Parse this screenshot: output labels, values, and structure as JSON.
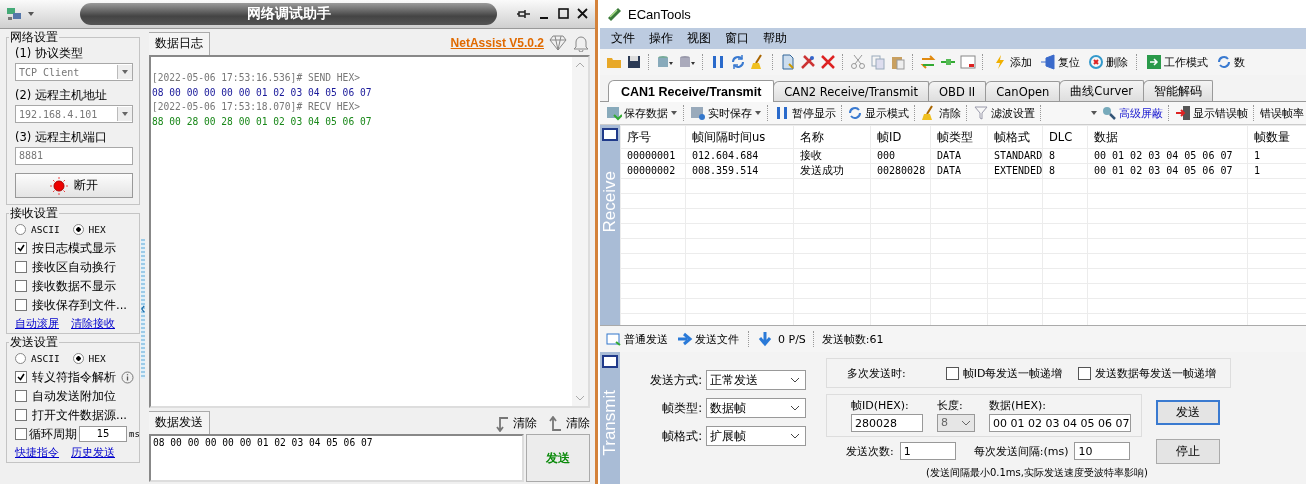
{
  "net_assist": {
    "window": {
      "title": "网络调试助手"
    },
    "network_settings": {
      "title": "网络设置",
      "fields": [
        {
          "label": "(1) 协议类型",
          "kind": "combo",
          "value": "TCP Client"
        },
        {
          "label": "(2) 远程主机地址",
          "kind": "combo",
          "value": "192.168.4.101"
        },
        {
          "label": "(3) 远程主机端口",
          "kind": "input",
          "value": "8881"
        }
      ],
      "connect_button": "断开"
    },
    "receive_settings": {
      "title": "接收设置",
      "encodings": [
        {
          "label": "ASCII",
          "selected": false
        },
        {
          "label": "HEX",
          "selected": true
        }
      ],
      "options": [
        {
          "label": "按日志模式显示",
          "checked": true
        },
        {
          "label": "接收区自动换行",
          "checked": false
        },
        {
          "label": "接收数据不显示",
          "checked": false
        },
        {
          "label": "接收保存到文件...",
          "checked": false
        }
      ],
      "links": [
        "自动滚屏",
        "清除接收"
      ]
    },
    "send_settings": {
      "title": "发送设置",
      "encodings": [
        {
          "label": "ASCII",
          "selected": false
        },
        {
          "label": "HEX",
          "selected": true
        }
      ],
      "options": [
        {
          "label": "转义符指令解析",
          "checked": true,
          "info": true
        },
        {
          "label": "自动发送附加位",
          "checked": false,
          "info": false
        },
        {
          "label": "打开文件数据源...",
          "checked": false,
          "info": false
        },
        {
          "label": "循环周期",
          "checked": false,
          "info": false,
          "value": "15",
          "unit": "ms"
        }
      ],
      "links": [
        "快捷指令",
        "历史发送"
      ]
    },
    "log": {
      "tab": "数据日志",
      "version_link": "NetAssist V5.0.2",
      "lines": [
        {
          "text": "[2022-05-06 17:53:16.536]# SEND HEX>",
          "kind": "header"
        },
        {
          "text": "08 00 00 00 00 00 01 02 03 04 05 06 07",
          "kind": "sent"
        },
        {
          "text": "[2022-05-06 17:53:18.070]# RECV HEX>",
          "kind": "header"
        },
        {
          "text": "88 00 28 00 28 00 01 02 03 04 05 06 07",
          "kind": "received"
        }
      ]
    },
    "send": {
      "tab": "数据发送",
      "clear_buttons": [
        "清除",
        "清除"
      ],
      "value": "08 00 00 00 00 00 01 02 03 04 05 06 07",
      "send_button": "发送"
    }
  },
  "ecan_tools": {
    "window": {
      "title": "ECanTools"
    },
    "menu": [
      "文件",
      "操作",
      "视图",
      "窗口",
      "帮助"
    ],
    "toolbar_buttons": [
      "添加",
      "复位",
      "删除",
      "工作模式",
      "数"
    ],
    "tabs": [
      {
        "label": "CAN1 Receive/Transmit",
        "selected": true
      },
      {
        "label": "CAN2 Receive/Transmit",
        "selected": false
      },
      {
        "label": "OBD II",
        "selected": false
      },
      {
        "label": "CanOpen",
        "selected": false
      },
      {
        "label": "曲线Curver",
        "selected": false
      },
      {
        "label": "智能解码",
        "selected": false
      }
    ],
    "receive_toolbar": [
      {
        "label": "保存数据",
        "kind": "dropdown"
      },
      {
        "label": "实时保存",
        "kind": "dropdown"
      },
      {
        "label": "暂停显示",
        "kind": "plain"
      },
      {
        "label": "显示模式",
        "kind": "plain"
      },
      {
        "label": "清除",
        "kind": "plain"
      },
      {
        "label": "滤波设置",
        "kind": "plain"
      },
      {
        "kind": "combo"
      },
      {
        "label": "高级屏蔽",
        "kind": "link"
      },
      {
        "label": "显示错误帧",
        "kind": "plain"
      },
      {
        "label": "错误帧率",
        "kind": "plain"
      }
    ],
    "receive_panel": {
      "label": "Receive",
      "columns": [
        "序号",
        "帧间隔时间us",
        "名称",
        "帧ID",
        "帧类型",
        "帧格式",
        "DLC",
        "数据",
        "帧数量"
      ],
      "rows": [
        [
          "00000001",
          "012.604.684",
          "接收",
          "000",
          "DATA",
          "STANDARD",
          "8",
          "00 01 02 03 04 05 06 07",
          "1"
        ],
        [
          "00000002",
          "008.359.514",
          "发送成功",
          "00280028",
          "DATA",
          "EXTENDED",
          "8",
          "00 01 02 03 04 05 06 07",
          "1"
        ]
      ]
    },
    "transmit_toolbar": {
      "buttons": [
        "普通发送",
        "发送文件"
      ],
      "rate": "0 P/S",
      "sent_count": "发送帧数:61"
    },
    "transmit_panel": {
      "label": "Transmit",
      "send_mode": {
        "label": "发送方式:",
        "value": "正常发送"
      },
      "frame_type": {
        "label": "帧类型:",
        "value": "数据帧"
      },
      "frame_format": {
        "label": "帧格式:",
        "value": "扩展帧"
      },
      "repeat": {
        "label": "多次发送时:",
        "options": [
          {
            "label": "帧ID每发送一帧递增",
            "checked": false
          },
          {
            "label": "发送数据每发送一帧递增",
            "checked": false
          }
        ]
      },
      "frame_id": {
        "label": "帧ID(HEX):",
        "value": "280028"
      },
      "length": {
        "label": "长度:",
        "value": "8",
        "disabled": true
      },
      "data": {
        "label": "数据(HEX):",
        "value": "00 01 02 03 04 05 06 07"
      },
      "count": {
        "label": "发送次数:",
        "value": "1"
      },
      "interval": {
        "label": "每次发送间隔:(ms)",
        "value": "10"
      },
      "note": "(发送间隔最小0.1ms,实际发送速度受波特率影响)",
      "buttons": [
        "发送",
        "停止"
      ]
    }
  }
}
